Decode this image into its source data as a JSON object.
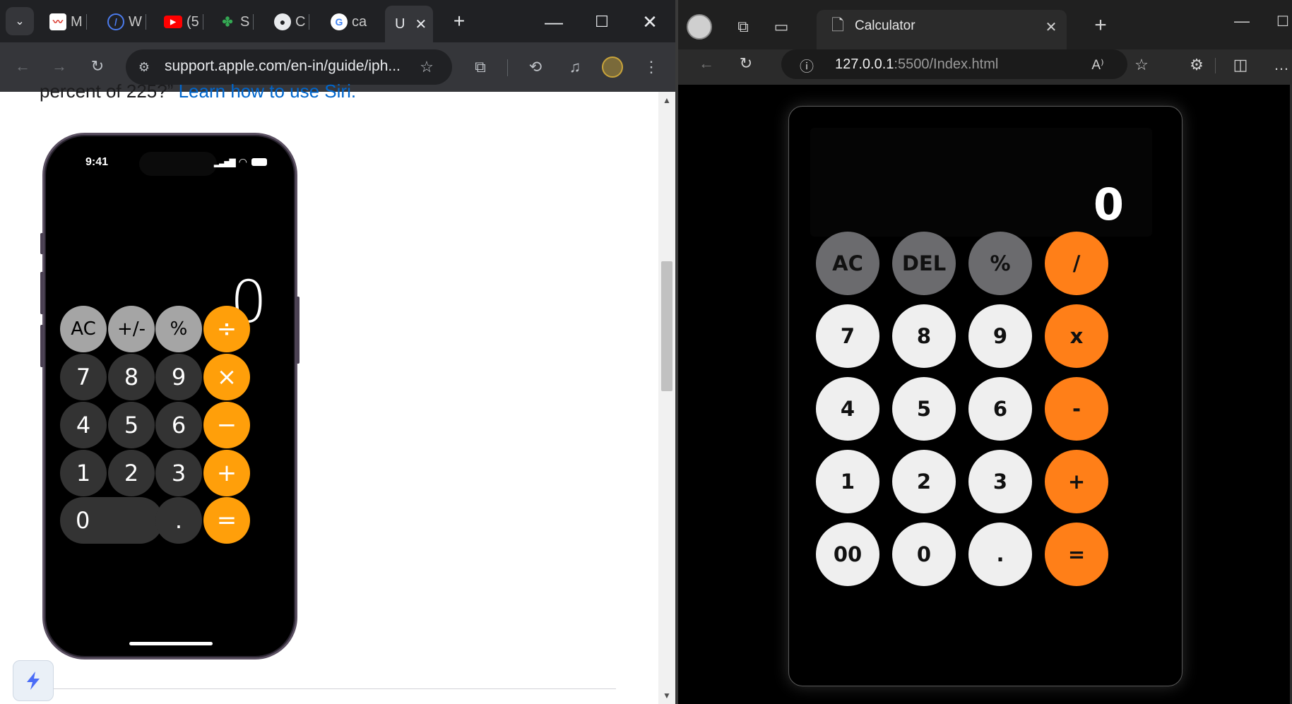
{
  "left_browser": {
    "tabs": [
      {
        "letter": "M",
        "icon": "chart-favicon"
      },
      {
        "letter": "W",
        "icon": "w-logo-favicon"
      },
      {
        "letter": "(5",
        "icon": "youtube-favicon"
      },
      {
        "letter": "S",
        "icon": "colorful-s-favicon"
      },
      {
        "letter": "C",
        "icon": "github-favicon"
      },
      {
        "letter": "ca",
        "icon": "google-favicon"
      }
    ],
    "active_tab_letter": "U",
    "url": "support.apple.com/en-in/guide/iph...",
    "page": {
      "text_before": "percent of 225?”",
      "link_text": "Learn how to use Siri.",
      "colors": {
        "link": "#0066cc"
      }
    },
    "phone": {
      "time": "9:41",
      "display": "0",
      "keys": [
        [
          "AC",
          "+/-",
          "%",
          "÷"
        ],
        [
          "7",
          "8",
          "9",
          "×"
        ],
        [
          "4",
          "5",
          "6",
          "−"
        ],
        [
          "1",
          "2",
          "3",
          "+"
        ],
        [
          "0",
          ".",
          "="
        ]
      ],
      "colors": {
        "function": "#a5a5a5",
        "number": "#333333",
        "operator": "#ff9f0a"
      }
    }
  },
  "right_browser": {
    "tab_title": "Calculator",
    "url_host": "127.0.0.1",
    "url_rest": ":5500/Index.html",
    "calculator": {
      "display": "0",
      "keys": [
        [
          "AC",
          "DEL",
          "%",
          "/"
        ],
        [
          "7",
          "8",
          "9",
          "x"
        ],
        [
          "4",
          "5",
          "6",
          "-"
        ],
        [
          "1",
          "2",
          "3",
          "+"
        ],
        [
          "00",
          "0",
          ".",
          "="
        ]
      ],
      "colors": {
        "function": "#6b6b6e",
        "number": "#efefef",
        "operator": "#ff7f18"
      }
    }
  }
}
